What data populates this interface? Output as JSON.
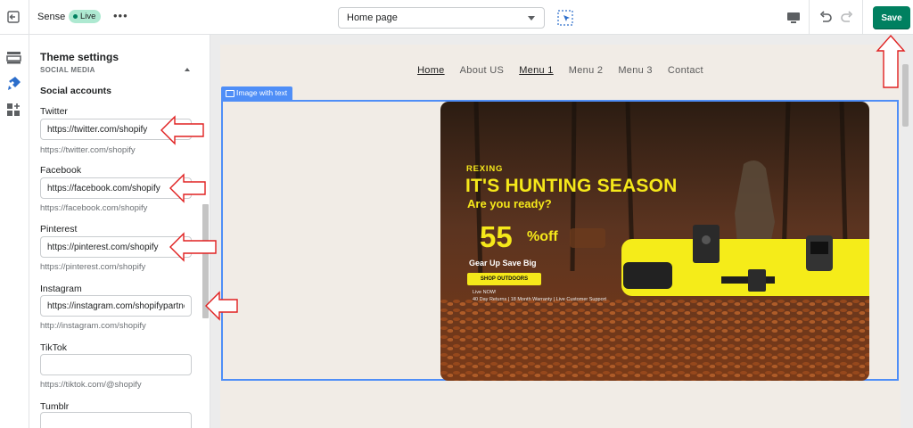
{
  "topbar": {
    "theme_name": "Sense",
    "status_badge": "Live",
    "more_label": "•••",
    "page_selector": "Home page",
    "save_label": "Save"
  },
  "panel": {
    "title": "Theme settings",
    "collapsed_section": "SOCIAL MEDIA",
    "section_heading": "Social accounts",
    "fields": [
      {
        "label": "Twitter",
        "value": "https://twitter.com/shopify",
        "help": "https://twitter.com/shopify"
      },
      {
        "label": "Facebook",
        "value": "https://facebook.com/shopify",
        "help": "https://facebook.com/shopify"
      },
      {
        "label": "Pinterest",
        "value": "https://pinterest.com/shopify",
        "help": "https://pinterest.com/shopify"
      },
      {
        "label": "Instagram",
        "value": "https://instagram.com/shopifypartne",
        "help": "http://instagram.com/shopify"
      },
      {
        "label": "TikTok",
        "value": "",
        "help": "https://tiktok.com/@shopify"
      },
      {
        "label": "Tumblr",
        "value": "",
        "help": ""
      }
    ]
  },
  "preview": {
    "nav": [
      "Home",
      "About US",
      "Menu 1",
      "Menu 2",
      "Menu 3",
      "Contact"
    ],
    "section_tag": "Image with text",
    "banner": {
      "brand": "REXING",
      "title": "IT'S HUNTING SEASON",
      "subtitle": "Are you ready?",
      "percent": "55",
      "off": "%off",
      "tagline": "Gear Up Save Big",
      "cta": "SHOP OUTDOORS",
      "fine1": "Live NOW!",
      "fine2": "40 Day Returns  |  18 Month Warranty  |  Live Customer Support"
    }
  },
  "colors": {
    "save_green": "#008060",
    "selection_blue": "#4f8ef7",
    "annotation_red": "#e02020",
    "banner_yellow": "#f5e81a"
  }
}
